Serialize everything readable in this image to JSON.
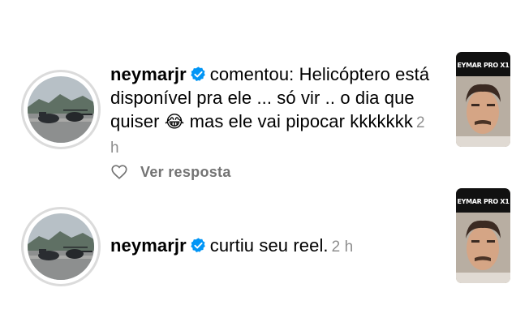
{
  "notifications": [
    {
      "username": "neymarjr",
      "action": "comentou: Helicóptero está disponível pra ele ... só vir .. o dia que quiser",
      "emoji": "😂",
      "action_tail": "mas ele vai pipocar kkkkkkk",
      "time": "2 h",
      "reply_label": "Ver resposta",
      "thumb_title": "EYMAR PRO X1"
    },
    {
      "username": "neymarjr",
      "action": "curtiu seu reel.",
      "time": "2 h",
      "thumb_title": "EYMAR PRO X1"
    }
  ],
  "colors": {
    "verified": "#0095f6",
    "muted": "#8e8e8e",
    "avatar_ring": "#dbdbdb"
  },
  "icons": [
    "verified-badge-icon",
    "heart-icon"
  ]
}
